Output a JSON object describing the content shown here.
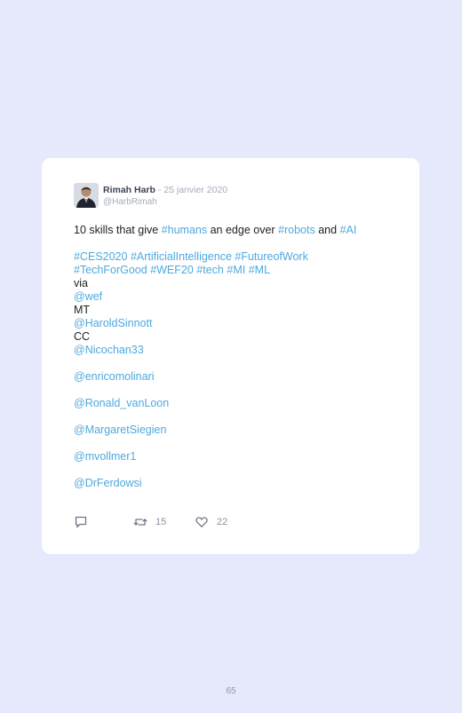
{
  "tweet": {
    "author_name": "Rimah Harb",
    "date_separator": " - ",
    "date": "25 janvier 2020",
    "handle": "@HarbRimah",
    "line1_prefix": "10 skills that give ",
    "hashtag_humans": "#humans",
    "line1_mid": " an edge over ",
    "hashtag_robots": "#robots",
    "line1_and": " and ",
    "hashtag_ai": "#AI",
    "hashtag_ces2020": "#CES2020",
    "hashtag_artificialintelligence": "#ArtificialIntelligence",
    "hashtag_futureofwork": "#FutureofWork",
    "hashtag_techforgood": "#TechForGood",
    "hashtag_wef20": "#WEF20",
    "hashtag_tech": "#tech",
    "hashtag_mi": "#MI",
    "hashtag_ml": "#ML",
    "via_text": "via",
    "mention_wef": "@wef",
    "mt_text": "MT",
    "mention_haroldsinnott": "@HaroldSinnott",
    "cc_text": "CC",
    "mention_nicochan33": "@Nicochan33",
    "mention_enricomolinari": "@enricomolinari",
    "mention_ronald_vanloon": "@Ronald_vanLoon",
    "mention_margaretsiegien": "@MargaretSiegien",
    "mention_mvollmer1": "@mvollmer1",
    "mention_drferdowsi": "@DrFerdowsi",
    "retweet_count": "15",
    "like_count": "22"
  },
  "page": {
    "number": "65"
  },
  "colors": {
    "page_background": "#e6e9fb",
    "card_background": "#ffffff",
    "link": "#4ea9df",
    "text": "#222222",
    "muted": "#a5acbc"
  },
  "icons": [
    "reply-icon",
    "retweet-icon",
    "like-icon"
  ]
}
